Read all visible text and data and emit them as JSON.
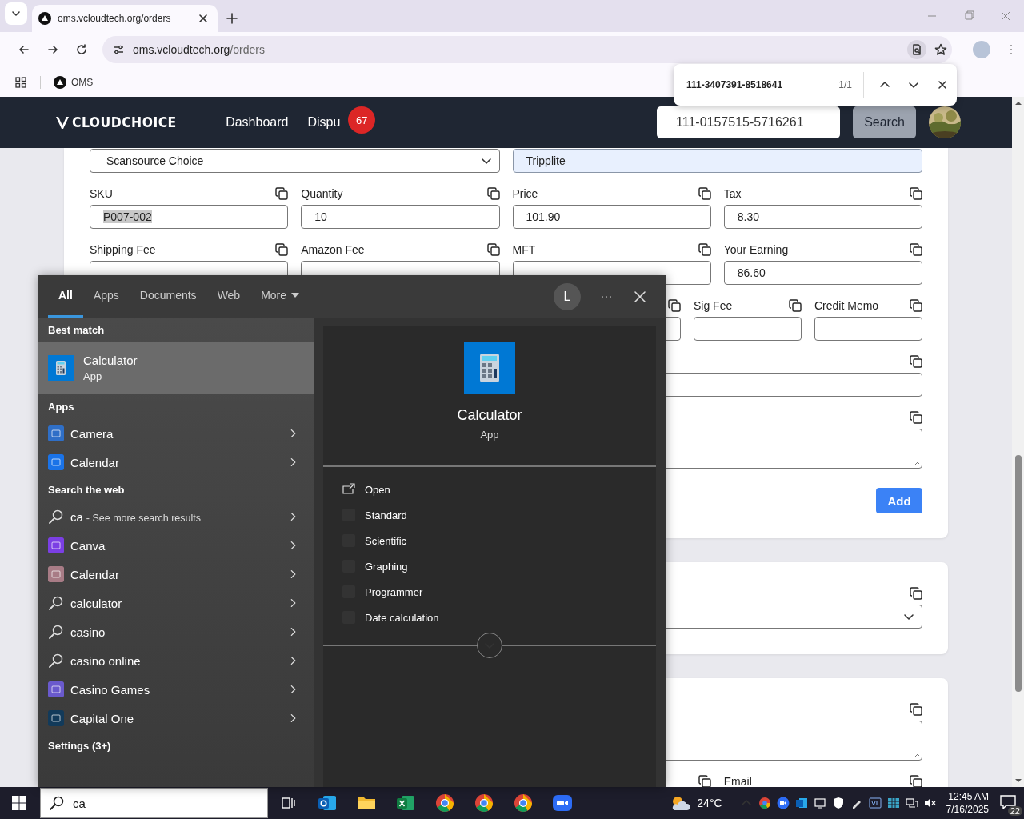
{
  "browser": {
    "tabs": [
      {
        "title": "oms.vcloudtech.org/orders",
        "selected": true
      }
    ],
    "address": {
      "host": "oms.vcloudtech.org",
      "path": "/orders"
    },
    "bookmarks": [
      {
        "label": "OMS"
      }
    ]
  },
  "find_bar": {
    "query": "111-3407391-8518641",
    "count": "1/1"
  },
  "navbar": {
    "logo": "CLOUDCHOICE",
    "links": [
      {
        "label": "Dashboard"
      },
      {
        "label": "Dispu",
        "badge": "67"
      }
    ],
    "search_value": "111-0157515-5716261",
    "search_button": "Search"
  },
  "cards": [
    {
      "rows": [
        {
          "kind": "pair",
          "fields": [
            {
              "kind": "select",
              "value": "Scansource Choice"
            },
            {
              "kind": "autofill",
              "value": "Tripplite"
            }
          ]
        },
        {
          "kind": "quad",
          "fields": [
            {
              "kind": "input",
              "label": "SKU",
              "value": "P007-002",
              "text_selected": true
            },
            {
              "kind": "input",
              "label": "Quantity",
              "value": "10",
              "text_selected": false
            },
            {
              "kind": "input",
              "label": "Price",
              "value": "101.90",
              "text_selected": false
            },
            {
              "kind": "input",
              "label": "Tax",
              "value": "8.30",
              "text_selected": false
            }
          ]
        },
        {
          "kind": "quad",
          "fields": [
            {
              "kind": "input",
              "label": "Shipping Fee"
            },
            {
              "kind": "input",
              "label": "Amazon Fee"
            },
            {
              "kind": "input",
              "label": "MFT"
            },
            {
              "kind": "input",
              "label": "Your Earning",
              "value": "86.60",
              "text_selected": false
            }
          ]
        },
        {
          "kind": "septet",
          "fields": [
            {
              "kind": "input"
            },
            {
              "kind": "input",
              "label": "Sig Fee"
            },
            {
              "kind": "input",
              "label": "Credit Memo"
            }
          ]
        },
        {
          "kind": "full",
          "fields": [
            {
              "kind": "input"
            }
          ]
        },
        {
          "kind": "full",
          "fields": [
            {
              "kind": "textarea"
            }
          ]
        }
      ],
      "button": "Add"
    },
    {
      "rows": [
        {
          "kind": "full",
          "fields": [
            {
              "kind": "select"
            }
          ]
        }
      ]
    },
    {
      "rows": [
        {
          "kind": "full",
          "fields": [
            {
              "kind": "textarea"
            }
          ]
        },
        {
          "kind": "split",
          "fields": [
            {
              "kind": "label"
            },
            {
              "kind": "label",
              "label": "Email"
            }
          ]
        }
      ]
    }
  ],
  "search_panel": {
    "tabs": [
      {
        "label": "All",
        "selected": true,
        "kind": "tab"
      },
      {
        "label": "Apps",
        "selected": false,
        "kind": "tab"
      },
      {
        "label": "Documents",
        "selected": false,
        "kind": "tab"
      },
      {
        "label": "Web",
        "selected": false,
        "kind": "tab"
      },
      {
        "label": "More",
        "selected": false,
        "kind": "menu"
      }
    ],
    "account": "L",
    "sections": [
      {
        "title": "Best match",
        "items": [
          {
            "kind": "best",
            "title": "Calculator",
            "subtitle": "App",
            "selected": true
          }
        ]
      },
      {
        "title": "Apps",
        "items": [
          {
            "kind": "app",
            "title": "Camera",
            "color": "#2f6fc7",
            "selected": false
          },
          {
            "kind": "app",
            "title": "Calendar",
            "color": "#1a73e8",
            "selected": false
          }
        ]
      },
      {
        "title": "Search the web",
        "items": [
          {
            "kind": "web",
            "title": "ca",
            "hint": "- See more search results",
            "selected": false
          },
          {
            "kind": "app",
            "title": "Canva",
            "color": "#7b3fe4",
            "selected": false
          },
          {
            "kind": "app",
            "title": "Calendar",
            "color": "#a87c86",
            "selected": false
          },
          {
            "kind": "search",
            "title": "calculator",
            "selected": false
          },
          {
            "kind": "search",
            "title": "casino",
            "selected": false
          },
          {
            "kind": "search",
            "title": "casino online",
            "selected": false
          },
          {
            "kind": "app",
            "title": "Casino Games",
            "color": "#6a5acd",
            "selected": false
          },
          {
            "kind": "app",
            "title": "Capital One",
            "color": "#123a5a",
            "selected": false
          }
        ]
      },
      {
        "title": "Settings (3+)"
      }
    ],
    "detail": {
      "title": "Calculator",
      "subtitle": "App",
      "actions": [
        {
          "kind": "open",
          "label": "Open"
        },
        {
          "kind": "mode",
          "label": "Standard"
        },
        {
          "kind": "mode",
          "label": "Scientific"
        },
        {
          "kind": "mode",
          "label": "Graphing"
        },
        {
          "kind": "mode",
          "label": "Programmer"
        },
        {
          "kind": "mode",
          "label": "Date calculation"
        }
      ]
    }
  },
  "taskbar": {
    "search_value": "ca",
    "apps": [
      {
        "kind": "outlook"
      },
      {
        "kind": "folder"
      },
      {
        "kind": "excel"
      },
      {
        "kind": "chrome"
      },
      {
        "kind": "chrome"
      },
      {
        "kind": "chrome"
      },
      {
        "kind": "zoom"
      }
    ],
    "weather": "24°C",
    "time": "12:45 AM",
    "date": "7/16/2025",
    "notifications": "22"
  }
}
